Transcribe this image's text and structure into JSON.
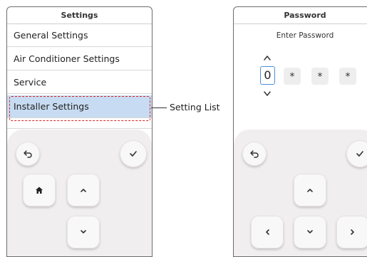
{
  "settings_screen": {
    "title": "Settings",
    "items": [
      {
        "label": "General Settings"
      },
      {
        "label": "Air Conditioner Settings"
      },
      {
        "label": "Service"
      },
      {
        "label": "Installer Settings",
        "selected": true
      }
    ]
  },
  "callout": {
    "label": "Setting List"
  },
  "password_screen": {
    "title": "Password",
    "prompt": "Enter Password",
    "digits": [
      "0",
      "*",
      "*",
      "*"
    ]
  },
  "icons": {
    "back": "back-arrow-icon",
    "confirm": "check-icon",
    "home": "home-icon",
    "up": "chevron-up-icon",
    "down": "chevron-down-icon",
    "left": "chevron-left-icon",
    "right": "chevron-right-icon"
  },
  "colors": {
    "selected_row": "#c7dcf2",
    "selection_outline": "#d8242b",
    "digit_outline": "#4a90d9",
    "keypad_bg": "#f1eef0"
  }
}
